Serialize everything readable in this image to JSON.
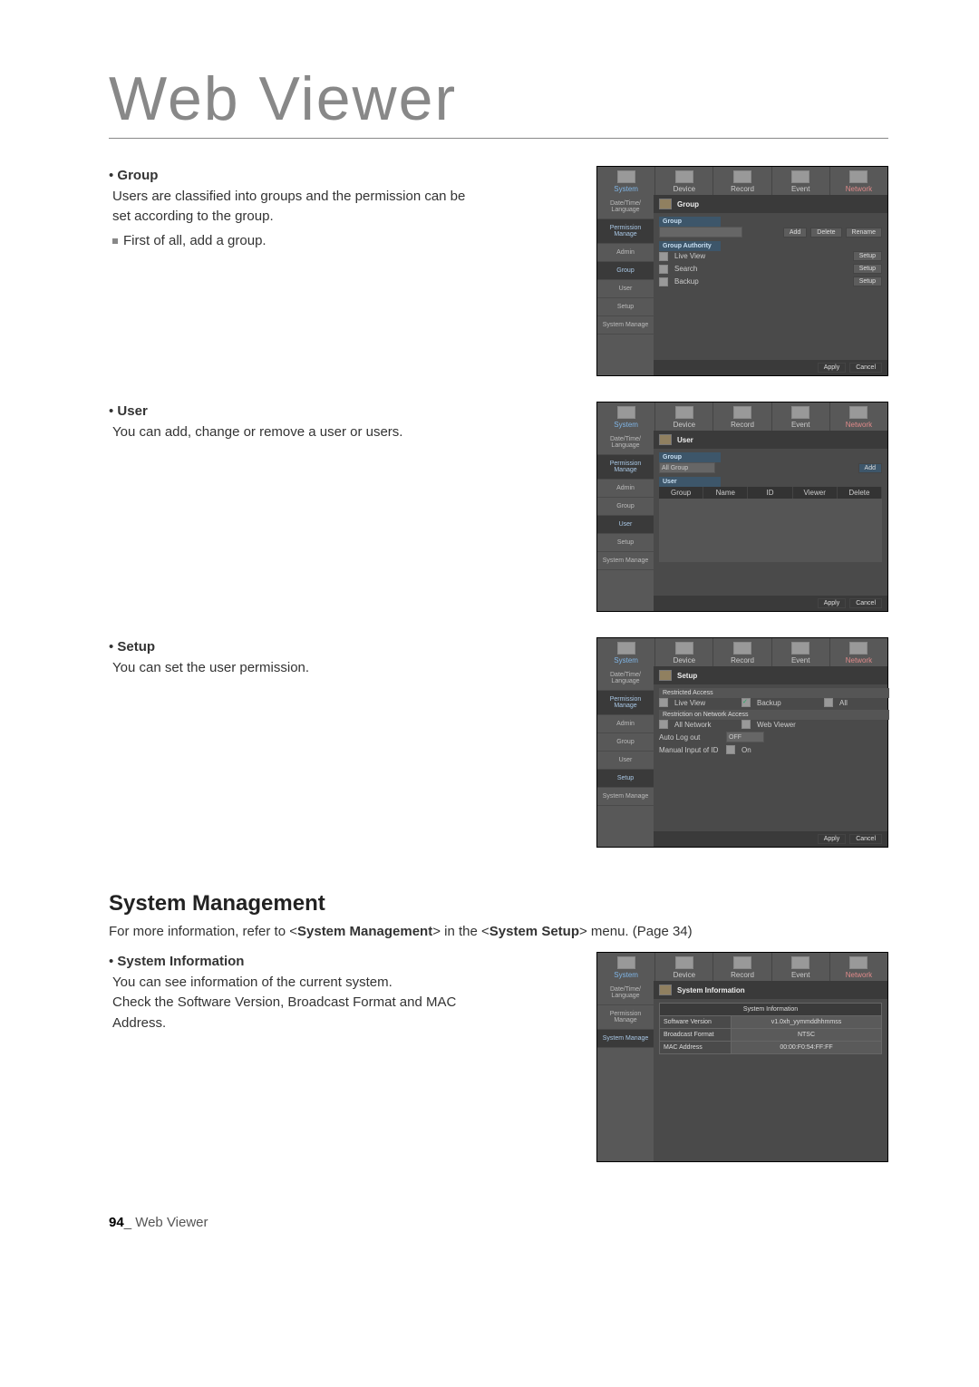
{
  "title": "Web Viewer",
  "group": {
    "heading": "Group",
    "desc": "Users are classified into groups and the permission can be set according to the group.",
    "bullet": "First of all, add a group."
  },
  "user": {
    "heading": "User",
    "desc": "You can add, change or remove a user or users."
  },
  "setup": {
    "heading": "Setup",
    "desc": "You can set the user permission."
  },
  "sysmgmt": {
    "heading": "System Management",
    "ref_a": "For more information, refer to <",
    "ref_b": "System Management",
    "ref_c": "> in the <",
    "ref_d": "System Setup",
    "ref_e": "> menu. (Page 34)"
  },
  "sysinfo": {
    "heading": "System Information",
    "desc1": "You can see information of the current system.",
    "desc2": "Check the Software Version, Broadcast Format and MAC Address."
  },
  "tabs": [
    "System",
    "Device",
    "Record",
    "Event",
    "Network"
  ],
  "side": {
    "s1": "Date/Time/\nLanguage",
    "s2": "Permission\nManage",
    "admin": "Admin",
    "group": "Group",
    "user": "User",
    "setup": "Setup",
    "sys": "System\nManage"
  },
  "shot1": {
    "panel": "Group",
    "subGroup": "Group",
    "subAuth": "Group Authority",
    "items": [
      "Live View",
      "Search",
      "Backup"
    ],
    "btnAdd": "Add",
    "btnDelete": "Delete",
    "btnRename": "Rename",
    "btnSetup": "Setup",
    "apply": "Apply",
    "cancel": "Cancel"
  },
  "shot2": {
    "panel": "User",
    "subGroup": "Group",
    "groupSel": "All Group",
    "subUser": "User",
    "cols": [
      "Group",
      "Name",
      "ID",
      "Viewer",
      "Delete"
    ],
    "btnAdd": "Add",
    "apply": "Apply",
    "cancel": "Cancel"
  },
  "shot3": {
    "panel": "Setup",
    "sec1": "Restricted Access",
    "c_live": "Live View",
    "c_backup": "Backup",
    "c_all": "All",
    "sec2": "Restriction on Network Access",
    "c_allnet": "All Network",
    "c_web": "Web Viewer",
    "autoLogout": "Auto Log out",
    "autoVal": "OFF",
    "manual": "Manual Input of ID",
    "manualOn": "On",
    "apply": "Apply",
    "cancel": "Cancel"
  },
  "shot4": {
    "panel": "System Information",
    "tableHdr": "System Information",
    "rows": [
      [
        "Software Version",
        "v1.0xh_yymmddhhmmss"
      ],
      [
        "Broadcast Format",
        "NTSC"
      ],
      [
        "MAC Address",
        "00:00:F0:54:FF:FF"
      ]
    ]
  },
  "footer": {
    "num": "94",
    "sep": "_",
    "text": " Web Viewer"
  }
}
